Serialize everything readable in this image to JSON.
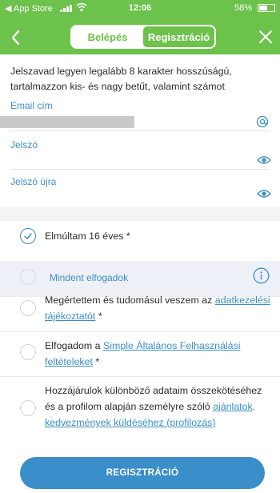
{
  "status_bar": {
    "back_app": "◀ App Store",
    "time": "12:06",
    "battery_pct": "58%"
  },
  "header": {
    "tabs": [
      {
        "label": "Belépés",
        "active": false
      },
      {
        "label": "Regisztráció",
        "active": true
      }
    ]
  },
  "info_text": "Jelszavad legyen legalább 8 karakter hosszúságú, tartalmazzon kis- és nagy betűt, valamint számot",
  "form": {
    "email_label": "Email cím",
    "password_label": "Jelszó",
    "password_confirm_label": "Jelszó újra"
  },
  "checkboxes": {
    "age": {
      "label": "Elmúltam 16 éves *",
      "checked": true
    },
    "accept_all": {
      "label": "Mindent elfogadok"
    },
    "privacy": {
      "text": "Megértettem és tudomásul veszem az ",
      "link": "adatkezelési tájékoztatót",
      "suffix": " *"
    },
    "terms": {
      "text": "Elfogadom a ",
      "link": "Simple Általános Felhasználási feltételeket",
      "suffix": " *"
    },
    "profiling": {
      "text": "Hozzájárulok különböző adataim összekötéséhez és a profilom alapján személyre szóló ",
      "link": "ajánlatok, kedvezmények küldéséhez (profilozás)",
      "suffix": ""
    }
  },
  "register_button": "REGISZTRÁCIÓ",
  "colors": {
    "brand_green": "#6cc24a",
    "accent_blue": "#3a8ec9"
  }
}
